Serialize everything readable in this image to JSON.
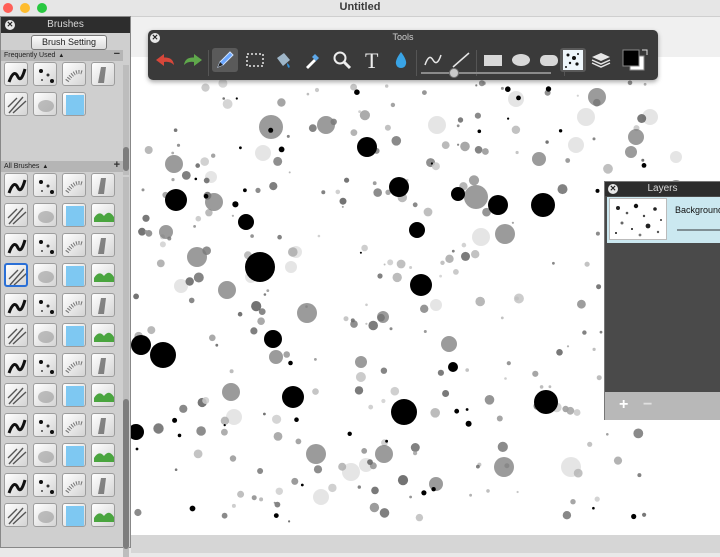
{
  "window": {
    "title": "Untitled"
  },
  "brushes_panel": {
    "title": "Brushes",
    "setting_button": "Brush Setting",
    "frequently_used_label": "Frequently Used",
    "all_brushes_label": "All Brushes"
  },
  "tools_panel": {
    "title": "Tools",
    "tools": [
      "undo-icon",
      "redo-icon",
      "pencil-icon",
      "rect-select-icon",
      "paint-bucket-icon",
      "eyedropper-icon",
      "magnifier-icon",
      "text-icon",
      "water-drop-icon",
      "curve-icon",
      "line-icon",
      "rectangle-icon",
      "ellipse-icon",
      "rounded-rect-icon",
      "texture-brush-icon",
      "layers-icon",
      "color-swatch-icon"
    ],
    "active_tool": "pencil-icon",
    "primary_color": "#000000",
    "secondary_color": "#ffffff"
  },
  "layers_panel": {
    "title": "Layers",
    "layers": [
      {
        "name": "Background"
      }
    ],
    "add_label": "+",
    "remove_label": "−"
  },
  "colors": {
    "panel_dark": "#3a3a3a",
    "accent_blue": "#2a6fd6",
    "layer_selected": "#cbe8f0",
    "undo_red": "#d7473a",
    "redo_green": "#5fa84b"
  }
}
